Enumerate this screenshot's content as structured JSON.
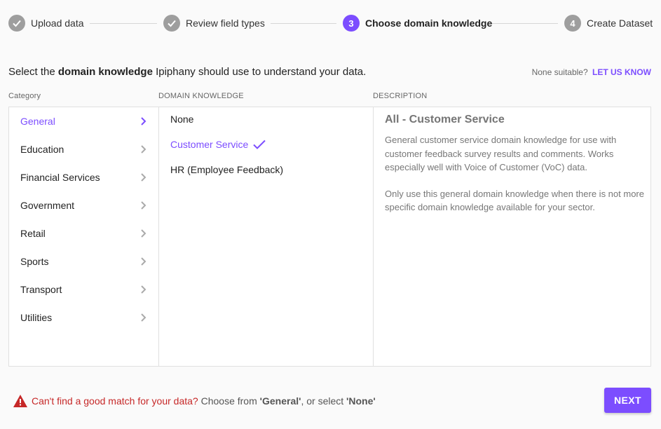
{
  "colors": {
    "accent": "#7c4dff",
    "done_step": "#9e9e9e",
    "warning": "#c62828"
  },
  "stepper": {
    "steps": [
      {
        "number": "",
        "label": "Upload data",
        "state": "done",
        "icon": "check-icon"
      },
      {
        "number": "",
        "label": "Review field types",
        "state": "done",
        "icon": "check-icon"
      },
      {
        "number": "3",
        "label": "Choose domain knowledge",
        "state": "active"
      },
      {
        "number": "4",
        "label": "Create Dataset",
        "state": "todo"
      }
    ]
  },
  "intro": {
    "prefix": "Select the ",
    "bold": "domain knowledge",
    "suffix": " Ipiphany should use to understand your data."
  },
  "help": {
    "question": "None suitable?",
    "link": "LET US KNOW"
  },
  "columns": {
    "category": "Category",
    "domain_knowledge": "DOMAIN KNOWLEDGE",
    "description": "DESCRIPTION"
  },
  "categories": [
    {
      "label": "General",
      "selected": true
    },
    {
      "label": "Education",
      "selected": false
    },
    {
      "label": "Financial Services",
      "selected": false
    },
    {
      "label": "Government",
      "selected": false
    },
    {
      "label": "Retail",
      "selected": false
    },
    {
      "label": "Sports",
      "selected": false
    },
    {
      "label": "Transport",
      "selected": false
    },
    {
      "label": "Utilities",
      "selected": false
    }
  ],
  "domain_items": [
    {
      "label": "None",
      "selected": false
    },
    {
      "label": "Customer Service",
      "selected": true
    },
    {
      "label": "HR (Employee Feedback)",
      "selected": false
    }
  ],
  "description": {
    "title": "All - Customer Service",
    "paragraphs": [
      "General customer service domain knowledge for use with customer feedback survey results and comments. Works especially well with Voice of Customer (VoC) data.",
      "Only use this general domain knowledge when there is not more specific domain knowledge available for your sector."
    ]
  },
  "footer": {
    "warning_strong": "Can't find a good match for your data?",
    "warning_mid": " Choose from ",
    "opt1": "'General'",
    "warning_or": ", or select ",
    "opt2": "'None'",
    "next_label": "NEXT"
  }
}
